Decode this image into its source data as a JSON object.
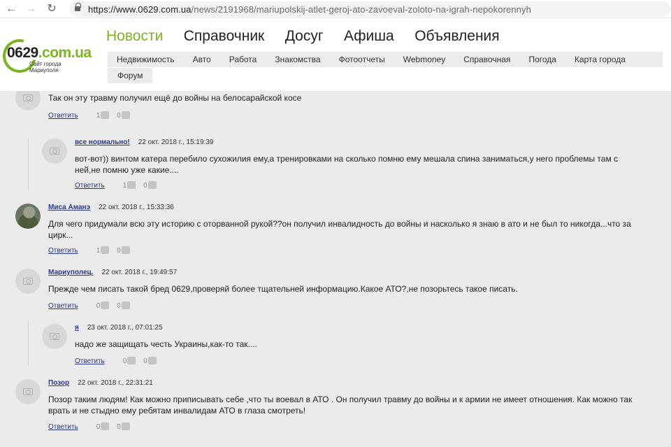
{
  "browser": {
    "url_host": "https://www.0629.com.ua",
    "url_path": "/news/2191968/mariupolskij-atlet-geroj-ato-zavoeval-zoloto-na-igrah-nepokorennyh"
  },
  "logo": {
    "main_a": "0629",
    "main_b": ".com.ua",
    "sub": "Сайт города Мариуполя"
  },
  "main_nav": [
    "Новости",
    "Справочник",
    "Досуг",
    "Афиша",
    "Объявления"
  ],
  "sub_nav": [
    "Недвижимость",
    "Авто",
    "Работа",
    "Знакомства",
    "Фотоотчеты",
    "Webmoney",
    "Справочная",
    "Погода",
    "Карта города"
  ],
  "sub_nav_row2": [
    "Форум"
  ],
  "reply_label": "Ответить",
  "comments": [
    {
      "author": "",
      "date": "",
      "text": "Так он эту травму получил ещё до войны на белосарайской косе",
      "likes": "1",
      "dislikes": "0"
    },
    {
      "author": "все нормально!",
      "date": "22 окт. 2018 г., 15:19:39",
      "text": "вот-вот)) винтом катера перебило сухожилия ему,а тренировками на сколько помню ему мешала спина заниматься,у него проблемы там с ней,не помню уже какие....",
      "likes": "1",
      "dislikes": "0"
    },
    {
      "author": "Миса Аманэ",
      "date": "22 окт. 2018 г., 15:33:36",
      "text": "Для чего придумали всю эту историю с оторванной рукой??он получил инвалидность до войны и насколько я знаю в ато и не был то никогда...что за цирк...",
      "likes": "1",
      "dislikes": "0"
    },
    {
      "author": "Мариуполец.",
      "date": "22 окт. 2018 г., 19:49:57",
      "text": "Прежде чем писать такой бред 0629,проверяй более тщательней информацию.Какое АТО?,не позорьтесь такое писать.",
      "likes": "0",
      "dislikes": "0"
    },
    {
      "author": "я",
      "date": "23 окт. 2018 г., 07:01:25",
      "text": "надо же защищать честь Украины,как-то так....",
      "likes": "0",
      "dislikes": "0"
    },
    {
      "author": "Позор",
      "date": "22 окт. 2018 г., 22:31:21",
      "text": "Позор таким людям! Как можно приписывать себе ,что ты воевал в АТО . Он получил травму до войны и к армии не имеет отношения. Как можно так врать и не стыдно ему ребятам инвалидам АТО в глаза смотреть!",
      "likes": "0",
      "dislikes": "0"
    }
  ]
}
